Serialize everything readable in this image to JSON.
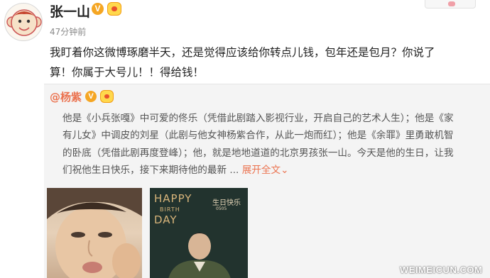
{
  "post": {
    "username": "张一山",
    "verified_mark": "V",
    "time": "47分钟前",
    "text_line1": "我盯着你这微博琢磨半天，还是觉得应该给你转点儿钱，包年还是包月？你说了",
    "text_line2": "算！你属于大号儿！！得给钱！"
  },
  "quote": {
    "username": "@杨紫",
    "verified_mark": "V",
    "text_line1": "他是《小兵张嘎》中可爱的佟乐（凭借此剧踏入影视行业，开启自己的艺术人生）；他是《家",
    "text_line2": "有儿女》中调皮的刘星（此剧与他女神杨紫合作，从此一炮而红）；他是《余罪》里勇敢机智",
    "text_line3": "的卧底（凭借此剧再度登峰）；他，就是地地道道的北京男孩张一山。今天是他的生日，让我",
    "text_line4": "们祝他生日快乐，接下来期待他的最新 ...",
    "expand_label": "展开全文",
    "expand_arrow": "⌄",
    "photo2_line1": "HAPPY",
    "photo2_line2": "BIRTH",
    "photo2_line3": "DAY",
    "photo2_side": "生日快乐",
    "photo2_date": "0505"
  },
  "watermark": "WEIMEICUN.COM",
  "colors": {
    "accent": "#eb7350",
    "verified": "#f5a623",
    "quote_bg": "#f4f4f4"
  },
  "icons": [
    "avatar-monkey-icon",
    "verified-v-icon",
    "level-badge-icon"
  ]
}
